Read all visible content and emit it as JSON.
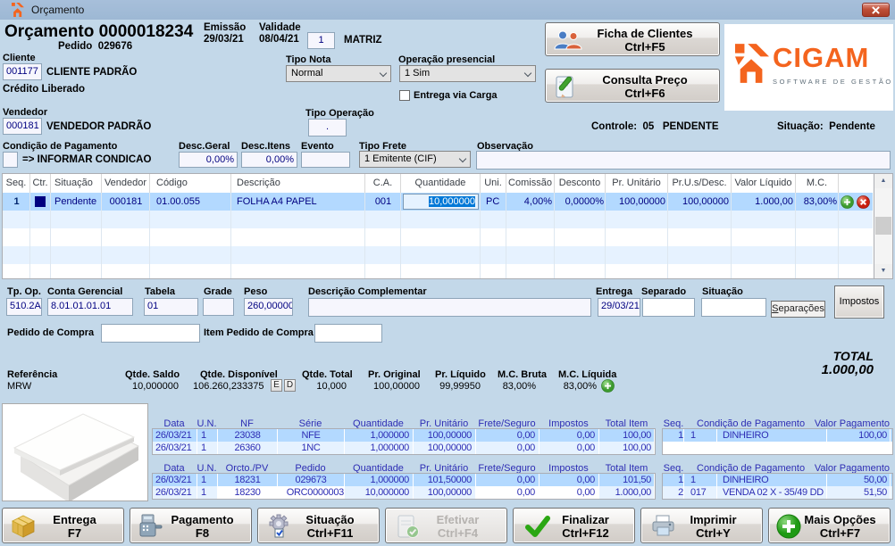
{
  "window": {
    "title": "Orçamento"
  },
  "header": {
    "title": "Orçamento 0000018234",
    "pedido_label": "Pedido",
    "pedido_value": "029676",
    "emissao_label": "Emissão",
    "emissao_value": "29/03/21",
    "validade_label": "Validade",
    "validade_value": "08/04/21",
    "unidade_value": "1",
    "matriz_label": "MATRIZ"
  },
  "cliente": {
    "label": "Cliente",
    "codigo": "001177",
    "nome": "CLIENTE PADRÃO",
    "credito": "Crédito Liberado",
    "tipo_nota_label": "Tipo Nota",
    "tipo_nota": "Normal",
    "operacao_label": "Operação presencial",
    "operacao": "1 Sim",
    "entrega_carga_label": "Entrega via Carga"
  },
  "acoes": {
    "ficha": "Ficha de Clientes",
    "ficha_atalho": "Ctrl+F5",
    "consulta": "Consulta Preço",
    "consulta_atalho": "Ctrl+F6"
  },
  "logo": {
    "nome": "CIGAM",
    "slogan": "SOFTWARE DE GESTÃO",
    "laranja": "#f4641e"
  },
  "vendedor": {
    "label": "Vendedor",
    "codigo": "000181",
    "nome": "VENDEDOR PADRÃO",
    "tipo_operacao_label": "Tipo Operação",
    "tipo_operacao": ".",
    "controle_label": "Controle:",
    "controle_num": "05",
    "controle_status": "PENDENTE",
    "situacao_label": "Situação:",
    "situacao": "Pendente"
  },
  "condicao": {
    "label": "Condição de Pagamento",
    "valor": "=> INFORMAR CONDICAO",
    "desc_geral_label": "Desc.Geral",
    "desc_geral": "0,00%",
    "desc_itens_label": "Desc.Itens",
    "desc_itens": "0,00%",
    "evento_label": "Evento",
    "tipo_frete_label": "Tipo Frete",
    "tipo_frete": "1 Emitente (CIF)",
    "observacao_label": "Observação"
  },
  "item_grid": {
    "headers": [
      "Seq.",
      "Ctr.",
      "Situação",
      "Vendedor",
      "Código",
      "Descrição",
      "C.A.",
      "Quantidade",
      "Uni.",
      "Comissão",
      "Desconto",
      "Pr. Unitário",
      "Pr.U.s/Desc.",
      "Valor Líquido",
      "M.C."
    ],
    "row": {
      "seq": "1",
      "situacao": "Pendente",
      "vendedor": "000181",
      "codigo": "01.00.055",
      "descricao": "FOLHA A4 PAPEL",
      "ca": "001",
      "quantidade": "10,000000",
      "uni": "PC",
      "comissao": "4,00%",
      "desconto": "0,0000%",
      "pr_unitario": "100,00000",
      "pr_us_desc": "100,00000",
      "valor_liquido": "1.000,00",
      "mc": "83,00%"
    }
  },
  "detalhe": {
    "tp_op_label": "Tp. Op.",
    "tp_op": "510.2A",
    "conta_label": "Conta Gerencial",
    "conta": "8.01.01.01.01",
    "tabela_label": "Tabela",
    "tabela": "01",
    "grade_label": "Grade",
    "peso_label": "Peso",
    "peso": "260,00000",
    "desc_compl_label": "Descrição Complementar",
    "entrega_label": "Entrega",
    "entrega": "29/03/21",
    "separado_label": "Separado",
    "situacao_label": "Situação",
    "separacoes_btn": "Separações",
    "impostos_btn": "Impostos",
    "pedido_compra_label": "Pedido de Compra",
    "item_pedido_label": "Item Pedido de Compra"
  },
  "totais": {
    "total_label": "TOTAL",
    "total": "1.000,00"
  },
  "referencia": {
    "label": "Referência",
    "valor": "MRW",
    "qtde_saldo_label": "Qtde. Saldo",
    "qtde_saldo": "10,000000",
    "qtde_disp_label": "Qtde. Disponível",
    "qtde_disp": "106.260,233375",
    "e_btn": "E",
    "d_btn": "D",
    "qtde_total_label": "Qtde. Total",
    "qtde_total": "10,000",
    "pr_original_label": "Pr. Original",
    "pr_original": "100,00000",
    "pr_liquido_label": "Pr. Líquido",
    "pr_liquido": "99,99950",
    "mc_bruta_label": "M.C. Bruta",
    "mc_bruta": "83,00%",
    "mc_liquida_label": "M.C. Líquida",
    "mc_liquida": "83,00%"
  },
  "historico_nf": {
    "headers": [
      "Data",
      "U.N.",
      "NF",
      "Série",
      "Quantidade",
      "Pr. Unitário",
      "Frete/Seguro",
      "Impostos",
      "Total Item"
    ],
    "rows": [
      [
        "26/03/21",
        "1",
        "23038",
        "NFE",
        "1,000000",
        "100,00000",
        "0,00",
        "0,00",
        "100,00"
      ],
      [
        "26/03/21",
        "1",
        "26360",
        "1NC",
        "1,000000",
        "100,00000",
        "0,00",
        "0,00",
        "100,00"
      ]
    ]
  },
  "historico_orc": {
    "headers": [
      "Data",
      "U.N.",
      "Orcto./PV",
      "Pedido",
      "Quantidade",
      "Pr. Unitário",
      "Frete/Seguro",
      "Impostos",
      "Total Item"
    ],
    "rows": [
      [
        "26/03/21",
        "1",
        "18231",
        "029673",
        "1,000000",
        "101,50000",
        "0,00",
        "0,00",
        "101,50"
      ],
      [
        "26/03/21",
        "1",
        "18230",
        "ORC0000003",
        "10,000000",
        "100,00000",
        "0,00",
        "0,00",
        "1.000,00"
      ]
    ]
  },
  "pagamento_nf": {
    "headers": [
      "Seq.",
      "Condição de Pagamento",
      "Valor Pagamento"
    ],
    "rows": [
      [
        "1",
        "1",
        "DINHEIRO",
        "100,00"
      ]
    ]
  },
  "pagamento_orc": {
    "headers": [
      "Seq.",
      "Condição de Pagamento",
      "Valor Pagamento"
    ],
    "rows": [
      [
        "1",
        "1",
        "DINHEIRO",
        "50,00"
      ],
      [
        "2",
        "017",
        "VENDA 02 X - 35/49 DD",
        "51,50"
      ]
    ]
  },
  "toolbar": {
    "buttons": [
      {
        "label": "Entrega",
        "atalho": "F7"
      },
      {
        "label": "Pagamento",
        "atalho": "F8"
      },
      {
        "label": "Situação",
        "atalho": "Ctrl+F11"
      },
      {
        "label": "Efetivar",
        "atalho": "Ctrl+F4"
      },
      {
        "label": "Finalizar",
        "atalho": "Ctrl+F12"
      },
      {
        "label": "Imprimir",
        "atalho": "Ctrl+Y"
      },
      {
        "label": "Mais Opções",
        "atalho": "Ctrl+F7"
      }
    ]
  }
}
